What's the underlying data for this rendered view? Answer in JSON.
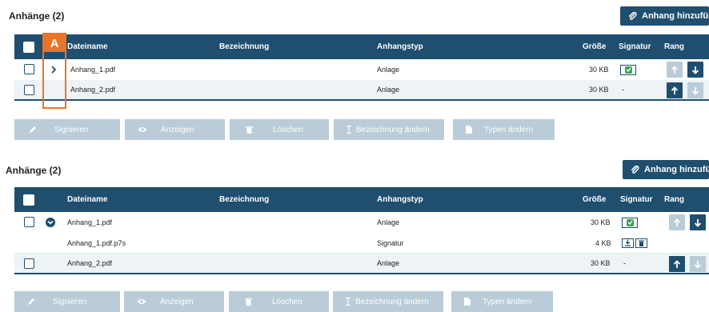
{
  "colors": {
    "primary": "#1f4e6e",
    "disabled": "#b9ccd8",
    "row_alt": "#eef3f6",
    "success": "#3aa15a",
    "marker": "#e5762a"
  },
  "section1": {
    "title": "Anhänge (2)",
    "add_button": "Anhang hinzufügen",
    "marker_label": "A",
    "headers": {
      "name": "Dateiname",
      "description": "Bezeichnung",
      "type": "Anhangstyp",
      "size": "Größe",
      "signature": "Signatur",
      "rank": "Rang"
    },
    "rows": [
      {
        "name": "Anhang_1.pdf",
        "type": "Anlage",
        "size": "30 KB",
        "signature_icon": "check-icon",
        "expand_icon": "chevron-right-icon",
        "rank_up_enabled": false,
        "rank_down_enabled": true
      },
      {
        "name": "Anhang_2.pdf",
        "type": "Anlage",
        "size": "30 KB",
        "signature": "-",
        "rank_up_enabled": true,
        "rank_down_enabled": false
      }
    ],
    "actions": {
      "sign": "Signieren",
      "view": "Anzeigen",
      "delete": "Löschen",
      "rename": "Bezeichnung ändern",
      "change_type": "Typen ändern"
    }
  },
  "section2": {
    "title": "Anhänge (2)",
    "add_button": "Anhang hinzufügen",
    "headers": {
      "name": "Dateiname",
      "description": "Bezeichnung",
      "type": "Anhangstyp",
      "size": "Größe",
      "signature": "Signatur",
      "rank": "Rang"
    },
    "rows": [
      {
        "name": "Anhang_1.pdf",
        "type": "Anlage",
        "size": "30 KB",
        "signature_icon": "check-icon",
        "expand_icon": "chevron-down-icon",
        "rank_up_enabled": false,
        "rank_down_enabled": true
      },
      {
        "name": "Anhang_1.pdf.p7s",
        "type": "Signatur",
        "size": "4 KB",
        "signature_icons": [
          "download-icon",
          "trash-icon"
        ]
      },
      {
        "name": "Anhang_2.pdf",
        "type": "Anlage",
        "size": "30 KB",
        "signature": "-",
        "rank_up_enabled": true,
        "rank_down_enabled": false
      }
    ],
    "actions": {
      "sign": "Signieren",
      "view": "Anzeigen",
      "delete": "Löschen",
      "rename": "Bezeichnung ändern",
      "change_type": "Typen ändern"
    }
  }
}
